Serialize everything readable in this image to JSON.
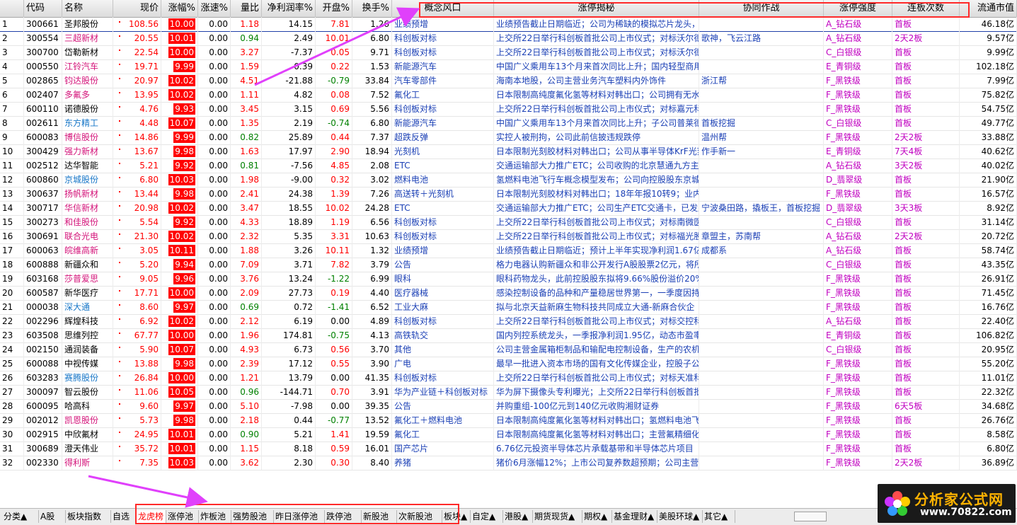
{
  "columns": [
    "",
    "代码",
    "名称",
    "现价",
    "涨幅%",
    "涨速%",
    "量比",
    "净利润率%",
    "开盘%",
    "换手%",
    "概念风口",
    "涨停揭秘",
    "协同作战",
    "涨停强度",
    "连板次数",
    "流通市值"
  ],
  "rows": [
    [
      "1",
      "300661",
      "圣邦股份",
      "108.56",
      "10.00",
      "0.00",
      "1.18",
      "14.15",
      "7.81",
      "1.26",
      "业绩预增",
      "业绩预告截止日期临近；公司为稀缺的模拟芯片龙头，",
      "",
      "A_钻石级",
      "首板",
      "46.18亿"
    ],
    [
      "2",
      "300554",
      "三超新材",
      "20.55",
      "10.01",
      "0.00",
      "0.94",
      "2.49",
      "10.01",
      "6.80",
      "科创板对标",
      "上交所22日举行科创板首批公司上市仪式；对标沃尔德",
      "歌神，飞云江路",
      "A_钻石级",
      "2天2板",
      "9.57亿"
    ],
    [
      "3",
      "300700",
      "岱勒新材",
      "22.54",
      "10.00",
      "0.00",
      "3.27",
      "-7.37",
      "0.05",
      "9.71",
      "科创板对标",
      "上交所22日举行科创板首批公司上市仪式；对标沃尔德",
      "",
      "C_白银级",
      "首板",
      "9.99亿"
    ],
    [
      "4",
      "000550",
      "江铃汽车",
      "19.71",
      "9.99",
      "0.00",
      "1.59",
      "0.39",
      "0.22",
      "1.53",
      "新能源汽车",
      "中国广义乘用车13个月来首次同比上升；国内轻型商用",
      "",
      "E_青铜级",
      "首板",
      "102.18亿"
    ],
    [
      "5",
      "002865",
      "钧达股份",
      "20.97",
      "10.02",
      "0.00",
      "4.51",
      "-21.88",
      "-0.79",
      "33.84",
      "汽车零部件",
      "海南本地股，公司主营业务汽车塑料内外饰件",
      "浙江帮",
      "F_黑铁级",
      "首板",
      "7.99亿"
    ],
    [
      "6",
      "002407",
      "多氟多",
      "13.95",
      "10.02",
      "0.00",
      "1.11",
      "4.82",
      "0.08",
      "7.52",
      "氟化工",
      "日本限制高纯度氟化氢等材料对韩出口；公司拥有无水",
      "",
      "F_黑铁级",
      "首板",
      "75.82亿"
    ],
    [
      "7",
      "600110",
      "诺德股份",
      "4.76",
      "9.93",
      "0.00",
      "3.45",
      "3.15",
      "0.69",
      "5.56",
      "科创板对标",
      "上交所22日举行科创板首批公司上市仪式；对标嘉元科",
      "",
      "F_黑铁级",
      "首板",
      "54.75亿"
    ],
    [
      "8",
      "002611",
      "东方精工",
      "4.48",
      "10.07",
      "0.00",
      "1.35",
      "2.19",
      "-0.74",
      "6.80",
      "新能源汽车",
      "中国广义乘用车13个月来首次同比上升；子公司普莱德",
      "首板挖掘",
      "C_白银级",
      "首板",
      "49.77亿"
    ],
    [
      "9",
      "600083",
      "博信股份",
      "14.86",
      "9.99",
      "0.00",
      "0.82",
      "25.89",
      "0.44",
      "7.37",
      "超跌反弹",
      "实控人被刑拘，公司此前信披违规跌停",
      "温州帮",
      "F_黑铁级",
      "2天2板",
      "33.88亿"
    ],
    [
      "10",
      "300429",
      "强力新材",
      "13.67",
      "9.98",
      "0.00",
      "1.63",
      "17.97",
      "2.90",
      "18.94",
      "光刻机",
      "日本限制光刻胶材料对韩出口；公司从事半导体KrF光刻",
      "作手新一",
      "E_青铜级",
      "7天4板",
      "40.62亿"
    ],
    [
      "11",
      "002512",
      "达华智能",
      "5.21",
      "9.92",
      "0.00",
      "0.81",
      "-7.56",
      "4.85",
      "2.08",
      "ETC",
      "交通运输部大力推广ETC；公司收购的北京慧通九方主",
      "",
      "A_钻石级",
      "3天2板",
      "40.02亿"
    ],
    [
      "12",
      "600860",
      "京城股份",
      "6.80",
      "10.03",
      "0.00",
      "1.98",
      "-9.00",
      "0.32",
      "3.02",
      "燃料电池",
      "氢燃料电池飞行车概念模型发布；公司向控股股东京城",
      "",
      "D_翡翠级",
      "首板",
      "21.90亿"
    ],
    [
      "13",
      "300637",
      "扬帆新材",
      "13.44",
      "9.98",
      "0.00",
      "2.41",
      "24.38",
      "1.39",
      "7.26",
      "高送转＋光刻机",
      "日本限制光刻胶材料对韩出口；18年年报10转9；业内",
      "",
      "F_黑铁级",
      "首板",
      "16.57亿"
    ],
    [
      "14",
      "300717",
      "华信新材",
      "20.98",
      "10.02",
      "0.00",
      "3.47",
      "18.55",
      "10.02",
      "24.28",
      "ETC",
      "交通运输部大力推广ETC；公司生产ETC交通卡，已发展",
      "宁波桑田路，撬板王，首板挖掘",
      "D_翡翠级",
      "3天3板",
      "8.92亿"
    ],
    [
      "15",
      "300273",
      "和佳股份",
      "5.54",
      "9.92",
      "0.00",
      "4.33",
      "18.89",
      "1.19",
      "6.56",
      "科创板对标",
      "上交所22日举行科创板首批公司上市仪式；对标南微医",
      "",
      "C_白银级",
      "首板",
      "31.14亿"
    ],
    [
      "16",
      "300691",
      "联合光电",
      "21.30",
      "10.02",
      "0.00",
      "2.32",
      "5.35",
      "3.31",
      "10.63",
      "科创板对标",
      "上交所22日举行科创板首批公司上市仪式；对标福光股",
      "章盟主，苏南帮",
      "A_钻石级",
      "2天2板",
      "20.72亿"
    ],
    [
      "17",
      "600063",
      "皖维高新",
      "3.05",
      "10.11",
      "0.00",
      "1.88",
      "3.26",
      "10.11",
      "1.32",
      "业绩预增",
      "业绩预告截止日期临近；预计上半年实现净利润1.67亿",
      "成都系",
      "A_钻石级",
      "首板",
      "58.74亿"
    ],
    [
      "18",
      "600888",
      "新疆众和",
      "5.20",
      "9.94",
      "0.00",
      "7.09",
      "3.71",
      "7.82",
      "3.79",
      "公告",
      "格力电器认购新疆众和非公开发行A股股票2亿元，将所",
      "",
      "C_白银级",
      "首板",
      "43.35亿"
    ],
    [
      "19",
      "603168",
      "莎普爱思",
      "9.05",
      "9.96",
      "0.00",
      "3.76",
      "13.24",
      "-1.22",
      "6.99",
      "眼科",
      "眼科药物龙头，此前控股股东拟将9.66%股份溢价20%",
      "",
      "F_黑铁级",
      "首板",
      "26.91亿"
    ],
    [
      "20",
      "600587",
      "新华医疗",
      "17.71",
      "10.00",
      "0.00",
      "2.09",
      "27.73",
      "0.19",
      "4.40",
      "医疗器械",
      "感染控制设备的品种和产量稳居世界第一，一季度因持",
      "",
      "F_黑铁级",
      "首板",
      "71.45亿"
    ],
    [
      "21",
      "000038",
      "深大通",
      "8.60",
      "9.97",
      "0.00",
      "0.69",
      "0.72",
      "-1.41",
      "6.52",
      "工业大麻",
      "拟与北京天益新麻生物科技共同成立大通-新麻合伙企",
      "",
      "F_黑铁级",
      "首板",
      "16.76亿"
    ],
    [
      "22",
      "002296",
      "辉煌科技",
      "6.92",
      "10.02",
      "0.00",
      "2.12",
      "6.19",
      "0.00",
      "4.89",
      "科创板对标",
      "上交所22日举行科创板首批公司上市仪式；对标交控科",
      "",
      "A_钻石级",
      "首板",
      "22.40亿"
    ],
    [
      "23",
      "603508",
      "思维列控",
      "67.77",
      "10.00",
      "0.00",
      "1.96",
      "174.81",
      "-0.75",
      "4.13",
      "高铁轨交",
      "国内列控系统龙头，一季报净利润1.95亿，动态市盈率",
      "",
      "E_青铜级",
      "首板",
      "106.82亿"
    ],
    [
      "24",
      "002150",
      "通润装备",
      "5.90",
      "10.07",
      "0.00",
      "4.93",
      "6.73",
      "0.56",
      "3.70",
      "其他",
      "公司主营金属箱柜制品和输配电控制设备，生产的农机",
      "",
      "C_白银级",
      "首板",
      "20.95亿"
    ],
    [
      "25",
      "600088",
      "中视传媒",
      "13.88",
      "9.98",
      "0.00",
      "2.39",
      "17.12",
      "0.55",
      "3.90",
      "广电",
      "最早一批进入资本市场的国有文化传媒企业，控股子公",
      "",
      "F_黑铁级",
      "首板",
      "55.20亿"
    ],
    [
      "26",
      "603283",
      "赛腾股份",
      "26.84",
      "10.00",
      "0.00",
      "1.21",
      "13.79",
      "0.00",
      "41.35",
      "科创板对标",
      "上交所22日举行科创板首批公司上市仪式；对标天准科",
      "",
      "F_黑铁级",
      "首板",
      "11.01亿"
    ],
    [
      "27",
      "300097",
      "智云股份",
      "11.06",
      "10.05",
      "0.00",
      "0.96",
      "-144.71",
      "0.70",
      "3.91",
      "华为产业链＋科创板对标",
      "华为屏下摄像头专利曝光；上交所22日举行科创板首批",
      "",
      "F_黑铁级",
      "首板",
      "22.32亿"
    ],
    [
      "28",
      "600095",
      "哈高科",
      "9.60",
      "9.97",
      "0.00",
      "5.10",
      "-7.98",
      "0.00",
      "39.35",
      "公告",
      "并购重组-100亿元到140亿元收购湘财证券",
      "",
      "F_黑铁级",
      "6天5板",
      "34.68亿"
    ],
    [
      "29",
      "002012",
      "凯恩股份",
      "5.73",
      "9.98",
      "0.00",
      "2.18",
      "0.44",
      "-0.77",
      "13.52",
      "氟化工＋燃料电池",
      "日本限制高纯度氟化氢等材料对韩出口；氢燃料电池飞",
      "",
      "F_黑铁级",
      "首板",
      "26.76亿"
    ],
    [
      "30",
      "002915",
      "中欣氟材",
      "24.95",
      "10.01",
      "0.00",
      "0.90",
      "5.21",
      "1.41",
      "19.59",
      "氟化工",
      "日本限制高纯度氟化氢等材料对韩出口；主营氟精细化",
      "",
      "F_黑铁级",
      "首板",
      "8.58亿"
    ],
    [
      "31",
      "300689",
      "澄天伟业",
      "35.72",
      "10.01",
      "0.00",
      "1.15",
      "8.18",
      "0.59",
      "16.01",
      "国产芯片",
      "6.76亿元投资半导体芯片承载基带和半导体芯片项目",
      "",
      "F_黑铁级",
      "首板",
      "6.80亿"
    ],
    [
      "32",
      "002330",
      "得利斯",
      "7.35",
      "10.03",
      "0.00",
      "3.62",
      "2.30",
      "0.30",
      "8.40",
      "养猪",
      "猪价6月涨幅12%；上市公司复养数超预期；公司主营生",
      "",
      "F_黑铁级",
      "2天2板",
      "36.89亿"
    ]
  ],
  "name_colors": [
    "blk",
    "nmred",
    "blk",
    "nmred",
    "nmred",
    "nmred",
    "blk",
    "nmblu",
    "nmred",
    "nmred",
    "blk",
    "nmblu",
    "nmred",
    "nmred",
    "nmred",
    "nmred",
    "nmred",
    "blk",
    "nmred",
    "blk",
    "nmblu",
    "blk",
    "blk",
    "blk",
    "blk",
    "nmblu",
    "blk",
    "blk",
    "nmred",
    "blk",
    "blk",
    "nmred"
  ],
  "tabs": [
    "分类▲",
    "A股",
    "板块指数",
    "自选",
    "龙虎榜",
    "涨停池",
    "炸板池",
    "强势股池",
    "昨日涨停池",
    "跌停池",
    "新股池",
    "次新股池",
    "板块▲",
    "自定▲",
    "港股▲",
    "期货现货▲",
    "期权▲",
    "基金理财▲",
    "美股环球▲",
    "其它▲"
  ],
  "active_tab": "龙虎榜",
  "logo": {
    "title": "分析家公式网",
    "url": "www.70822.com"
  },
  "colors": {
    "up_bg": "#ff0000",
    "annotation": "#ff2a2a",
    "arrow": "#e040fb"
  }
}
